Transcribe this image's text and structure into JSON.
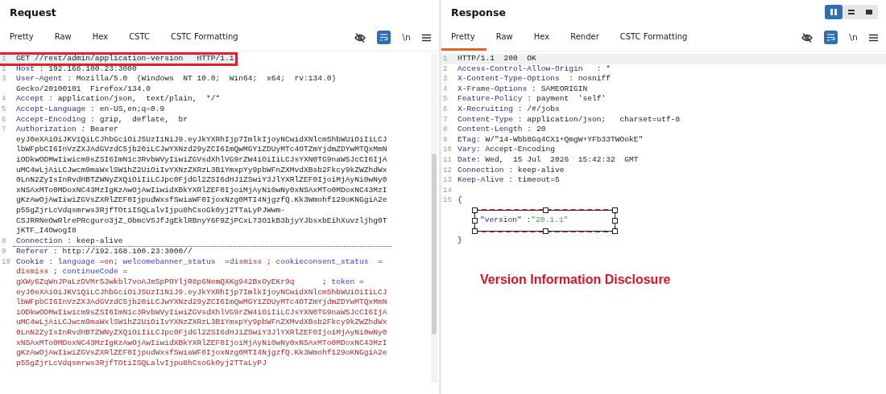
{
  "request": {
    "title": "Request",
    "tabs": [
      {
        "label": "Pretty",
        "selected": false
      },
      {
        "label": "Raw",
        "selected": false
      },
      {
        "label": "Hex",
        "selected": false
      },
      {
        "label": "CSTC",
        "selected": false
      },
      {
        "label": "CSTC Formatting",
        "selected": false
      }
    ],
    "tools": {
      "wrap_on": true,
      "newline": {
        "label": "\\n",
        "on": false
      }
    },
    "lines": [
      {
        "n": "1",
        "current": true,
        "marked": false,
        "boxed": true,
        "segs": [
          {
            "kind": "text",
            "text": "GET //rest/admin/application-version   HTTP/1.1"
          }
        ]
      },
      {
        "n": "2",
        "current": false,
        "marked": false,
        "segs": [
          {
            "kind": "key",
            "text": "Host"
          },
          {
            "kind": "text",
            "text": " : 192.168.100.23:3000"
          }
        ]
      },
      {
        "n": "3",
        "current": false,
        "marked": false,
        "segs": [
          {
            "kind": "key",
            "text": "User-Agent"
          },
          {
            "kind": "text",
            "text": " : Mozilla/5.0  (Windows  NT 10.0;  Win64;  x64;  rv:134.0)  Gecko/20100101  Firefox/134.0"
          }
        ]
      },
      {
        "n": "4",
        "current": false,
        "marked": false,
        "segs": [
          {
            "kind": "key",
            "text": "Accept"
          },
          {
            "kind": "text",
            "text": " : application/json,  text/plain,  */*"
          }
        ]
      },
      {
        "n": "5",
        "current": false,
        "marked": false,
        "segs": [
          {
            "kind": "key",
            "text": "Accept-Language"
          },
          {
            "kind": "text",
            "text": " : en-US,en;q=0.9"
          }
        ]
      },
      {
        "n": "6",
        "current": false,
        "marked": false,
        "segs": [
          {
            "kind": "key",
            "text": "Accept-Encoding"
          },
          {
            "kind": "text",
            "text": " : gzip,  deflate,  br"
          }
        ]
      },
      {
        "n": "7",
        "current": false,
        "marked": false,
        "segs": [
          {
            "kind": "key",
            "text": "Authorization"
          },
          {
            "kind": "text",
            "text": " : Bearer eyJ0eXAiOiJKV1QiLCJhbGciOiJSUzI1NiJ9.eyJkYXRhIjp7ImlkIjoyNCwidXNlcm5hbWUiOiIiLCJlbWFpbCI6InVzZXJAdGVzdC5jb20iLCJwYXNzd29yZCI6ImQwMGY1ZDUyMTc4OTZmYjdmZDYwMTQxMmNiODkwODMwIiwicm9sZSI6ImN1c3RvbWVyIiwiZGVsdXhlVG9rZW4iOiIiLCJsYXN0TG9naW5JcCI6IjAuMC4wLjAiLCJwcm9maWxlSW1hZ2UiOiIvYXNzZXRzL3B1YmxpYy9pbWFnZXMvdXBsb2Fkcy9kZWZhdWx0LnN2ZyIsInRvdHBTZWNyZXQiOiIiLCJpc0FjdGl2ZSI6dHJ1ZSwiY3JlYXRlZEF0IjoiMjAyNi0wNy0xNSAxMTo0MDoxNC43MzIgKzAwOjAwIiwidXBkYXRlZEF0IjoiMjAyNi0wNy0xNSAxMTo0MDoxNC43MzIgKzAwOjAwIiwiZGVsZXRlZEF0IjpudWxsfSwiaWF0IjoxNzg0MTI4NjgzfQ.Kk3Wmohf129oKNGgiA2ep55gZjrLcVdqsmrws3RjfTOtiISQLalvIjpu8hCsoGk0yj2TTaLyPJWwm-CSJRRNeOwRlrePRcguro3jZ_ObmcVSJfJgEklRBnyY6F9ZjPCxL73O1kB3bjyYJbsxbEihXuvzljhg0TjKTF_I4OwogI8"
          }
        ]
      },
      {
        "n": "8",
        "current": false,
        "marked": true,
        "segs": [
          {
            "kind": "key",
            "text": "Connection"
          },
          {
            "kind": "text",
            "text": " : keep-alive"
          }
        ]
      },
      {
        "n": "9",
        "current": false,
        "marked": false,
        "segs": [
          {
            "kind": "key",
            "text": "Referer"
          },
          {
            "kind": "text",
            "text": " : http://192.168.100.23:3000//"
          }
        ]
      },
      {
        "n": "10",
        "current": false,
        "marked": false,
        "segs": [
          {
            "kind": "key",
            "text": "Cookie"
          },
          {
            "kind": "text",
            "text": " : "
          },
          {
            "kind": "cname",
            "text": "language"
          },
          {
            "kind": "text",
            "text": " ="
          },
          {
            "kind": "cval",
            "text": "en"
          },
          {
            "kind": "text",
            "text": "; "
          },
          {
            "kind": "cname",
            "text": "welcomebanner_status"
          },
          {
            "kind": "text",
            "text": "  ="
          },
          {
            "kind": "cval",
            "text": "dismiss"
          },
          {
            "kind": "text",
            "text": " ; "
          },
          {
            "kind": "cname",
            "text": "cookieconsent_status"
          },
          {
            "kind": "text",
            "text": "  = "
          },
          {
            "kind": "cval",
            "text": "dismiss"
          },
          {
            "kind": "text",
            "text": " ; "
          },
          {
            "kind": "cname",
            "text": "continueCode"
          },
          {
            "kind": "text",
            "text": " = "
          },
          {
            "kind": "cval",
            "text": "gXWy6ZqWnJPaLzDVMr53wkbl7voAJmSpPOYljR8p6NemQXKg942BxOyEKr9q"
          },
          {
            "kind": "text",
            "text": "      ; "
          },
          {
            "kind": "cname",
            "text": "token"
          },
          {
            "kind": "text",
            "text": " = "
          },
          {
            "kind": "cval",
            "text": "eyJ0eXAiOiJKV1QiLCJhbGciOiJSUzI1NiJ9.eyJkYXRhIjp7ImlkIjoyNCwidXNlcm5hbWUiOiIiLCJlbWFpbCI6InVzZXJAdGVzdC5jb20iLCJwYXNzd29yZCI6ImQwMGY1ZDUyMTc4OTZmYjdmZDYwMTQxMmNiODkwODMwIiwicm9sZSI6ImN1c3RvbWVyIiwiZGVsdXhlVG9rZW4iOiIiLCJsYXN0TG9naW5JcCI6IjAuMC4wLjAiLCJwcm9maWxlSW1hZ2UiOiIvYXNzZXRzL3B1YmxpYy9pbWFnZXMvdXBsb2Fkcy9kZWZhdWx0LnN2ZyIsInRvdHBTZWNyZXQiOiIiLCJpc0FjdGl2ZSI6dHJ1ZSwiY3JlYXRlZEF0IjoiMjAyNi0wNy0xNSAxMTo0MDoxNC43MzIgKzAwOjAwIiwidXBkYXRlZEF0IjoiMjAyNi0wNy0xNSAxMTo0MDoxNC43MzIgKzAwOjAwIiwiZGVsZXRlZEF0IjpudWxsfSwiaWF0IjoxNzg0MTI4NjgzfQ.Kk3Wmohf129oKNGgiA2ep55gZjrLcVdqsmrws3RjfTOtiISQLalvIjpu8hCsoGk0yj2TTaLyPJ"
          }
        ]
      }
    ]
  },
  "response": {
    "title": "Response",
    "layouts": [
      {
        "kind": "columns",
        "selected": true
      },
      {
        "kind": "rows",
        "selected": false
      },
      {
        "kind": "single",
        "selected": false
      }
    ],
    "tabs": [
      {
        "label": "Pretty",
        "selected": true
      },
      {
        "label": "Raw",
        "selected": false
      },
      {
        "label": "Hex",
        "selected": false
      },
      {
        "label": "Render",
        "selected": false
      },
      {
        "label": "CSTC Formatting",
        "selected": false
      }
    ],
    "tools": {
      "wrap_on": true,
      "newline": {
        "label": "\\n",
        "on": false
      }
    },
    "lines": [
      {
        "n": "1",
        "current": true,
        "marked": false,
        "segs": [
          {
            "kind": "text",
            "text": "HTTP/1.1  200  OK"
          }
        ]
      },
      {
        "n": "2",
        "current": false,
        "marked": false,
        "segs": [
          {
            "kind": "key",
            "text": "Access-Control-Allow-Origin"
          },
          {
            "kind": "text",
            "text": "   : *"
          }
        ]
      },
      {
        "n": "3",
        "current": false,
        "marked": false,
        "segs": [
          {
            "kind": "key",
            "text": "X-Content-Type-Options"
          },
          {
            "kind": "text",
            "text": "  : nosniff"
          }
        ]
      },
      {
        "n": "4",
        "current": false,
        "marked": false,
        "segs": [
          {
            "kind": "key",
            "text": "X-Frame-Options"
          },
          {
            "kind": "text",
            "text": " : SAMEORIGIN"
          }
        ]
      },
      {
        "n": "5",
        "current": false,
        "marked": false,
        "segs": [
          {
            "kind": "key",
            "text": "Feature-Policy"
          },
          {
            "kind": "text",
            "text": " : payment  'self'"
          }
        ]
      },
      {
        "n": "6",
        "current": false,
        "marked": false,
        "segs": [
          {
            "kind": "key",
            "text": "X-Recruiting"
          },
          {
            "kind": "text",
            "text": " : /#/jobs"
          }
        ]
      },
      {
        "n": "7",
        "current": false,
        "marked": false,
        "segs": [
          {
            "kind": "key",
            "text": "Content-Type"
          },
          {
            "kind": "text",
            "text": " : application/json;   charset=utf-8"
          }
        ]
      },
      {
        "n": "8",
        "current": false,
        "marked": false,
        "segs": [
          {
            "kind": "key",
            "text": "Content-Length"
          },
          {
            "kind": "text",
            "text": " : 20"
          }
        ]
      },
      {
        "n": "9",
        "current": false,
        "marked": false,
        "segs": [
          {
            "kind": "key",
            "text": "ETag"
          },
          {
            "kind": "text",
            "text": ": W/\"14-Wbb8Gq4CX1+QmgW+YFb33TWOokE\""
          }
        ]
      },
      {
        "n": "10",
        "current": false,
        "marked": false,
        "segs": [
          {
            "kind": "key",
            "text": "Vary"
          },
          {
            "kind": "text",
            "text": ": Accept-Encoding"
          }
        ]
      },
      {
        "n": "11",
        "current": false,
        "marked": false,
        "segs": [
          {
            "kind": "key",
            "text": "Date"
          },
          {
            "kind": "text",
            "text": ": Wed,  15 Jul  2026  15:42:32  GMT"
          }
        ]
      },
      {
        "n": "12",
        "current": false,
        "marked": false,
        "segs": [
          {
            "kind": "key",
            "text": "Connection"
          },
          {
            "kind": "text",
            "text": " : keep-alive"
          }
        ]
      },
      {
        "n": "13",
        "current": false,
        "marked": false,
        "segs": [
          {
            "kind": "key",
            "text": "Keep-Alive"
          },
          {
            "kind": "text",
            "text": " : timeout=5"
          }
        ]
      },
      {
        "n": "14",
        "current": false
      },
      {
        "n": "15",
        "current": false,
        "marked": false,
        "segs": [
          {
            "kind": "text",
            "text": "{"
          }
        ]
      },
      {
        "current": false,
        "marked": false,
        "boxed": true,
        "segs": [
          {
            "kind": "jkey",
            "text": "\"version\""
          },
          {
            "kind": "text",
            "text": " :"
          },
          {
            "kind": "jstr",
            "text": "\"20.1.1\""
          }
        ]
      },
      {
        "current": false,
        "marked": false,
        "segs": [
          {
            "kind": "text",
            "text": "}"
          }
        ]
      }
    ],
    "annotation": "Version Information Disclosure"
  }
}
